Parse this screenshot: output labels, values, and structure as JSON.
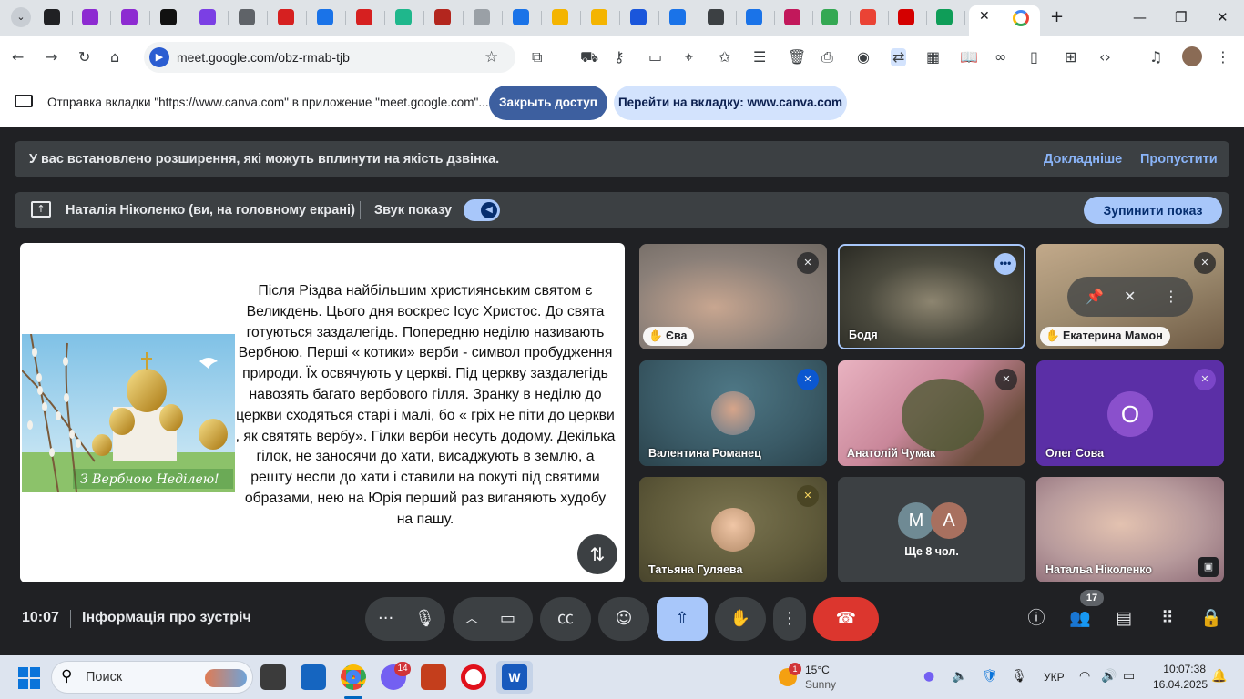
{
  "browser": {
    "url": "meet.google.com/obz-rmab-tjb",
    "tab_icon_colors": [
      "#202124",
      "#8d2bd1",
      "#8d2bd1",
      "#111111",
      "#7b3fe4",
      "#5f6368",
      "#d62020",
      "#1a73e8",
      "#d62020",
      "#1fb78c",
      "#b3261e",
      "#9aa0a6",
      "#1a73e8",
      "#f4b400",
      "#f4b400",
      "#1a56db",
      "#1a73e8",
      "#3c4043",
      "#1a73e8",
      "#c2185b",
      "#34a853",
      "#ea4335",
      "#d40000",
      "#0f9d58"
    ],
    "active_tab_icon": "google-g-icon"
  },
  "infobar": {
    "text": "Отправка вкладки \"https://www.canva.com\" в приложение \"meet.google.com\"...",
    "close_access": "Закрыть доступ",
    "goto_tab": "Перейти на вкладку: www.canva.com"
  },
  "meet": {
    "extension_banner": "У вас встановлено розширення, які можуть вплинути на якість дзвінка.",
    "learn_more": "Докладніше",
    "skip": "Пропустити",
    "presenter": "Наталія Ніколенко (ви, на головному екрані)",
    "sound_label": "Звук показу",
    "stop_sharing": "Зупинити показ",
    "slide_text": "Після Різдва найбільшим християнським святом є Великдень. Цього дня воскрес Ісус Христос. До свята готуються заздалегідь. Попередню неділю називають Вербною. Перші « котики» верби - символ пробудження природи. Їх освячують у церкві. Під церкву заздалегідь навозять багато вербового гілля. Зранку в неділю до церкви сходяться старі і малі, бо « гріх не піти до церкви , як святять вербу». Гілки верби несуть додому. Декілька гілок, не заносячи до хати, висаджують в землю, а решту несли до хати і ставили на покуті під святими образами, нею на Юрія перший раз виганяють худобу на пашу.",
    "slide_image_caption": "З Вербною Неділею!",
    "participants": [
      {
        "name": "Єва",
        "bg": "#8a7f78"
      },
      {
        "name": "Бодя",
        "bg": "#4b4a3e"
      },
      {
        "name": "Екатерина Мамон",
        "bg": "#9c8a6e"
      },
      {
        "name": "Валентина Романец",
        "bg": "#3a5a66"
      },
      {
        "name": "Анатолій Чумак",
        "bg": "#c9879a"
      },
      {
        "name": "Олег Сова",
        "initial": "О",
        "bg": "#5b2fa6",
        "avatar_bg": "#8a50cc"
      },
      {
        "name": "Татьяна Гуляева",
        "bg": "#5f5a3a"
      },
      {
        "name": "Ще 8 чол.",
        "initials": [
          "М",
          "А"
        ],
        "avatar_colors": [
          "#6f8a94",
          "#a8705f"
        ],
        "bg": "#3c4043"
      },
      {
        "name": "Натальа Ніколенко",
        "bg": "#b79a9c"
      }
    ],
    "time": "10:07",
    "meeting_info": "Інформація про зустріч",
    "people_count": "17"
  },
  "taskbar": {
    "search_placeholder": "Поиск",
    "viber_badge": "14",
    "weather_badge": "1",
    "weather_temp": "15°C",
    "weather_desc": "Sunny",
    "lang": "УКР",
    "clock_time": "10:07:38",
    "clock_date": "16.04.2025"
  }
}
